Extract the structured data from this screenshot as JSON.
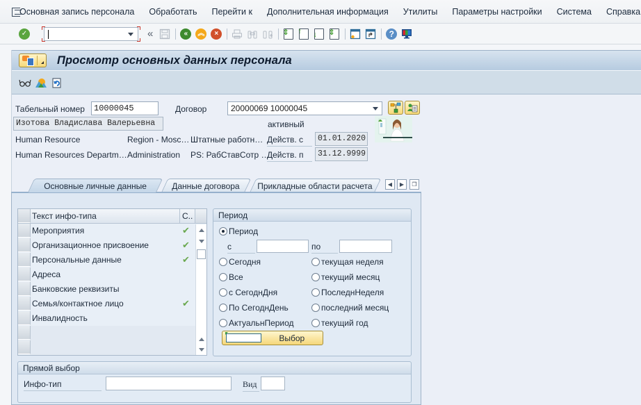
{
  "menubar": {
    "items": [
      {
        "label": "Основная запись персонала"
      },
      {
        "label": "Обработать"
      },
      {
        "label": "Перейти к"
      },
      {
        "label": "Дополнительная информация"
      },
      {
        "label": "Утилиты"
      },
      {
        "label": "Параметры настройки"
      },
      {
        "label": "Система"
      },
      {
        "label": "Справка"
      }
    ]
  },
  "toolbar": {
    "command_field": {
      "value": "",
      "placeholder": ""
    },
    "icons": [
      "enter-icon",
      "save-icon",
      "back-icon",
      "exit-icon",
      "cancel-icon",
      "print-icon",
      "find-icon",
      "find-next-icon",
      "first-page-icon",
      "previous-page-icon",
      "next-page-icon",
      "last-page-icon",
      "new-session-icon",
      "shortcut-icon",
      "help-icon",
      "customize-layout-icon"
    ]
  },
  "screen": {
    "title": "Просмотр основных данных персонала",
    "app_toolbar_icons": [
      "display-icon",
      "overview-icon",
      "change-view-icon"
    ]
  },
  "header": {
    "personnel_number_label": "Табельный номер",
    "personnel_number": "10000045",
    "contract_label": "Договор",
    "contract_value": "20000069 10000045",
    "employee_name": "Изотова Владислава Валерьевна",
    "status": "активный",
    "row1": {
      "col1": "Human Resource",
      "col2": "Region - Mosc…",
      "col3": "Штатные работн…",
      "valid_from_label": "Действ. с",
      "valid_from": "01.01.2020"
    },
    "row2": {
      "col1": "Human Resources Departm…",
      "col2": "Administration",
      "col3": "PS: РабСтавСотр …",
      "valid_to_label": "Действ. п",
      "valid_to": "31.12.9999"
    }
  },
  "tabs": [
    {
      "label": "Основные личные данные",
      "active": true
    },
    {
      "label": "Данные договора",
      "active": false
    },
    {
      "label": "Прикладные области расчета",
      "active": false
    }
  ],
  "infotype_table": {
    "columns": [
      "Текст инфо-типа",
      "С.."
    ],
    "rows": [
      {
        "text": "Мероприятия",
        "checked": true
      },
      {
        "text": "Организационное присвоение",
        "checked": true
      },
      {
        "text": "Персональные данные",
        "checked": true
      },
      {
        "text": "Адреса",
        "checked": false
      },
      {
        "text": "Банковские реквизиты",
        "checked": false
      },
      {
        "text": "Семья/контактное лицо",
        "checked": true
      },
      {
        "text": "Инвалидность",
        "checked": false
      }
    ],
    "check_glyph": "✔"
  },
  "period": {
    "title": "Период",
    "period_option": "Период",
    "from_label": "с",
    "from_value": "",
    "to_label": "по",
    "to_value": "",
    "options_left": [
      "Сегодня",
      "Все",
      "с СегоднДня",
      "По СегоднДень",
      "АктуальнПериод"
    ],
    "options_right": [
      "текущая неделя",
      "текущий месяц",
      "ПоследнНеделя",
      "последний месяц",
      "текущий год"
    ],
    "selected": "Период",
    "choose_button": "Выбор"
  },
  "direct_selection": {
    "title": "Прямой выбор",
    "infotype_label": "Инфо-тип",
    "infotype_value": "",
    "subtype_label": "Вид",
    "subtype_value": ""
  }
}
